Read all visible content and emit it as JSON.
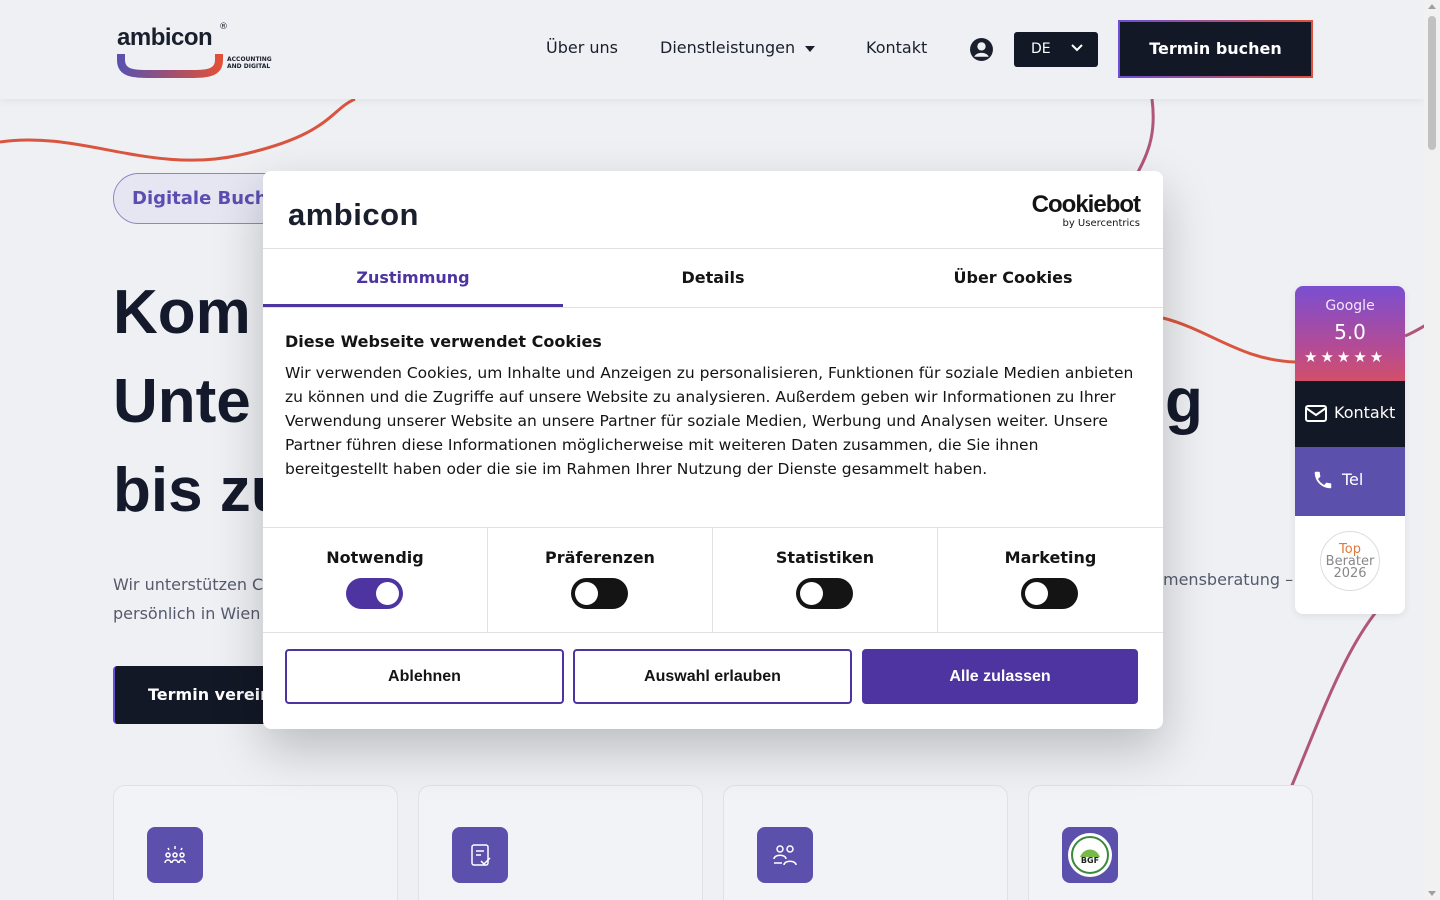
{
  "header": {
    "logo_word": "ambicon",
    "logo_reg": "®",
    "logo_sub": "ACCOUNTING AND DIGITAL",
    "nav": [
      {
        "label": "Über uns"
      },
      {
        "label": "Dienstleistungen"
      },
      {
        "label": "Kontakt"
      }
    ],
    "language": "DE",
    "cta_label": "Termin buchen"
  },
  "hero": {
    "badge": "Digitale Buchh",
    "title_lines": [
      "Kom",
      "Unte",
      "bis zu"
    ],
    "title_right_fragment": "g",
    "text_left": "Wir unterstützen C persönlich in Wien",
    "text_right": "mensberatung –",
    "cta_label": "Termin verein"
  },
  "widget": {
    "google_label": "Google",
    "google_score": "5.0",
    "stars": "★★★★★",
    "kontakt_label": "Kontakt",
    "tel_label": "Tel",
    "top_badge": [
      "Top",
      "Berater",
      "2026"
    ]
  },
  "cookie_dialog": {
    "brand": "ambicon",
    "provider_main": "Cookiebot",
    "provider_sub": "by Usercentrics",
    "tabs": [
      {
        "label": "Zustimmung",
        "active": true
      },
      {
        "label": "Details",
        "active": false
      },
      {
        "label": "Über Cookies",
        "active": false
      }
    ],
    "heading": "Diese Webseite verwendet Cookies",
    "body": "Wir verwenden Cookies, um Inhalte und Anzeigen zu personalisieren, Funktionen für soziale Medien anbieten zu können und die Zugriffe auf unsere Website zu analysieren. Außerdem geben wir Informationen zu Ihrer Verwendung unserer Website an unsere Partner für soziale Medien, Werbung und Analysen weiter. Unsere Partner führen diese Informationen möglicherweise mit weiteren Daten zusammen, die Sie ihnen bereitgestellt haben oder die sie im Rahmen Ihrer Nutzung der Dienste gesammelt haben.",
    "toggles": [
      {
        "label": "Notwendig",
        "on": true
      },
      {
        "label": "Präferenzen",
        "on": false
      },
      {
        "label": "Statistiken",
        "on": false
      },
      {
        "label": "Marketing",
        "on": false
      }
    ],
    "buttons": {
      "decline": "Ablehnen",
      "allow_selection": "Auswahl erlauben",
      "allow_all": "Alle zulassen"
    }
  },
  "colors": {
    "accent": "#4d34a0",
    "dark": "#131826",
    "purple_tile": "#5b51ad"
  }
}
